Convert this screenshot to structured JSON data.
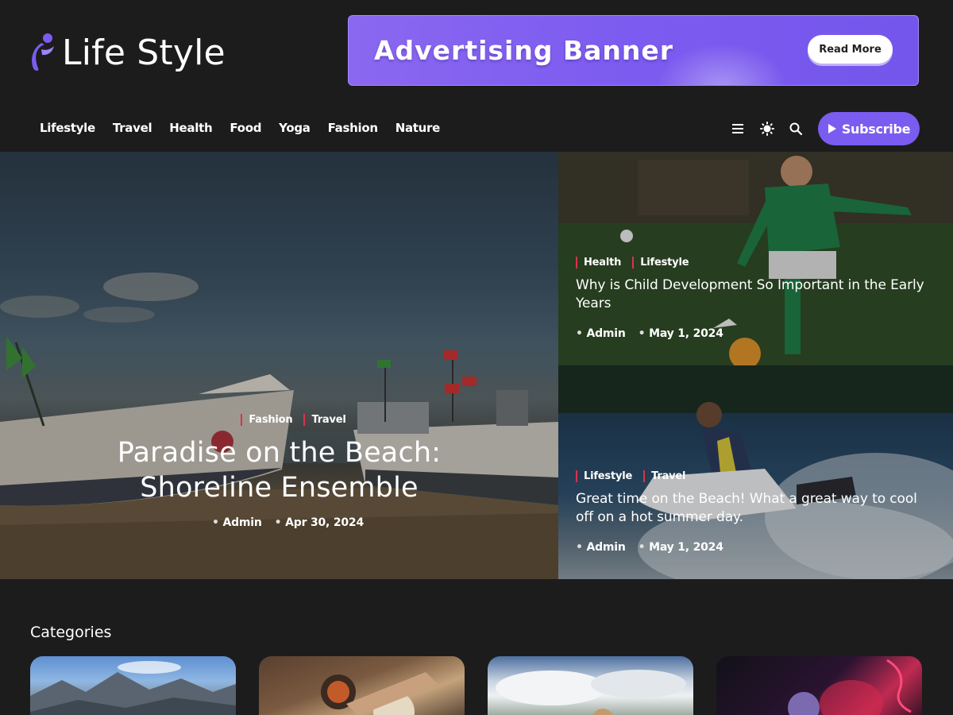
{
  "header": {
    "site_title": "Life Style",
    "ad": {
      "title": "Advertising Banner",
      "button_label": "Read More"
    }
  },
  "nav": {
    "items": [
      {
        "label": "Lifestyle"
      },
      {
        "label": "Travel"
      },
      {
        "label": "Health"
      },
      {
        "label": "Food"
      },
      {
        "label": "Yoga"
      },
      {
        "label": "Fashion"
      },
      {
        "label": "Nature"
      }
    ],
    "tools": [
      "menu-icon",
      "theme-toggle-icon",
      "search-icon"
    ],
    "subscribe_label": "Subscribe"
  },
  "hero": {
    "main": {
      "tags": [
        "Fashion",
        "Travel"
      ],
      "title": "Paradise on the Beach: Shoreline Ensemble",
      "author": "Admin",
      "date": "Apr 30, 2024"
    },
    "side": [
      {
        "tags": [
          "Health",
          "Lifestyle"
        ],
        "title": "Why is Child Development So Important in the Early Years",
        "author": "Admin",
        "date": "May 1, 2024"
      },
      {
        "tags": [
          "Lifestyle",
          "Travel"
        ],
        "title": "Great time on the Beach! What a great way to cool off on a hot summer day.",
        "author": "Admin",
        "date": "May 1, 2024"
      }
    ]
  },
  "categories": {
    "heading": "Categories"
  },
  "colors": {
    "accent": "#7b5cf0",
    "background": "#1c1c1d",
    "tag_marker": "#d9334a"
  }
}
